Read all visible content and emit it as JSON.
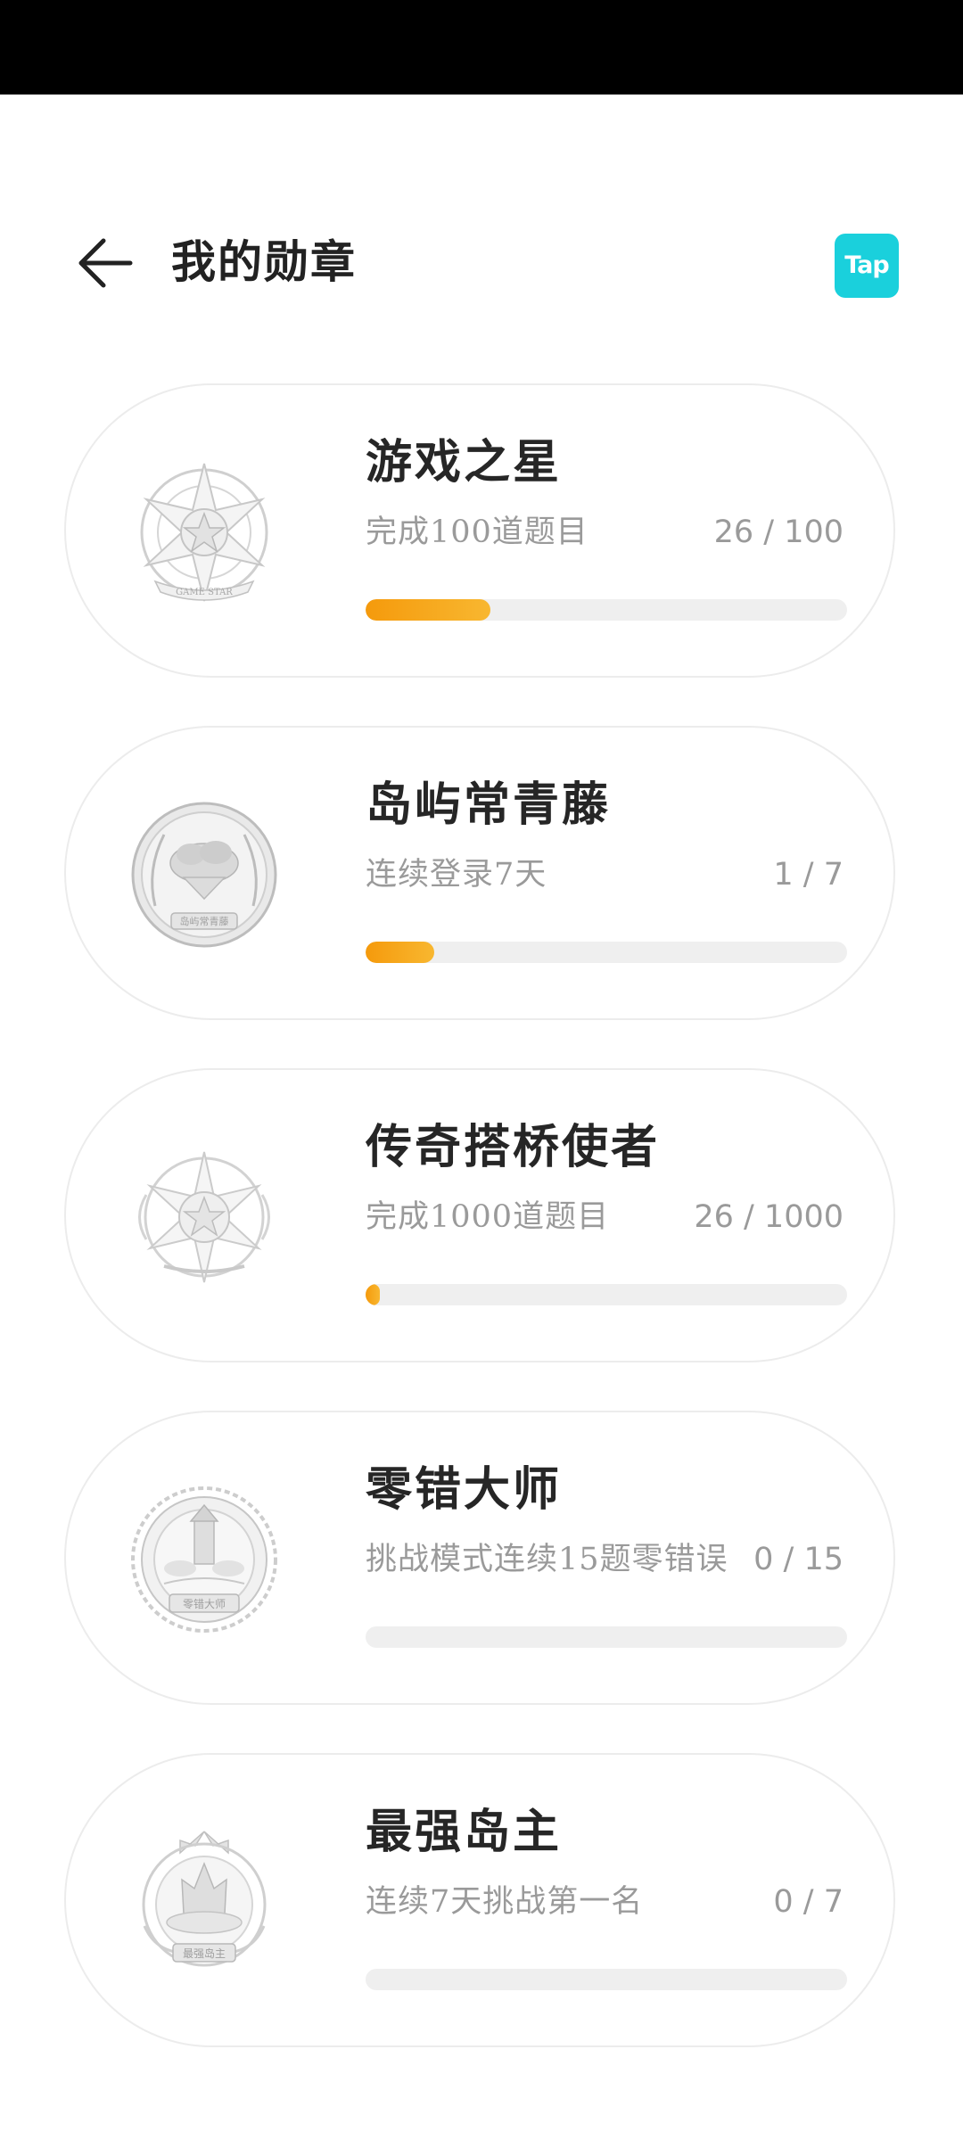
{
  "header": {
    "title": "我的勋章",
    "logo_text": "Tap"
  },
  "colors": {
    "accent": "#f7a51d",
    "logo_bg": "#1ad0dc",
    "track": "#efefef"
  },
  "badges": [
    {
      "name": "游戏之星",
      "description": "完成100道题目",
      "progress_text": "26 / 100",
      "progress": 0.26,
      "icon": "game-star-medal-icon",
      "medal_text": "GAME STAR"
    },
    {
      "name": "岛屿常青藤",
      "description": "连续登录7天",
      "progress_text": "1 / 7",
      "progress": 0.143,
      "icon": "island-ivy-medal-icon",
      "medal_text": "岛屿常青藤"
    },
    {
      "name": "传奇搭桥使者",
      "description": "完成1000道题目",
      "progress_text": "26 / 1000",
      "progress": 0.026,
      "icon": "legend-bridge-medal-icon",
      "medal_text": ""
    },
    {
      "name": "零错大师",
      "description": "挑战模式连续15题零错误",
      "progress_text": "0 / 15",
      "progress": 0,
      "icon": "zero-error-master-medal-icon",
      "medal_text": "零错大师"
    },
    {
      "name": "最强岛主",
      "description": "连续7天挑战第一名",
      "progress_text": "0 / 7",
      "progress": 0,
      "icon": "strongest-island-lord-medal-icon",
      "medal_text": "最强岛主"
    }
  ]
}
